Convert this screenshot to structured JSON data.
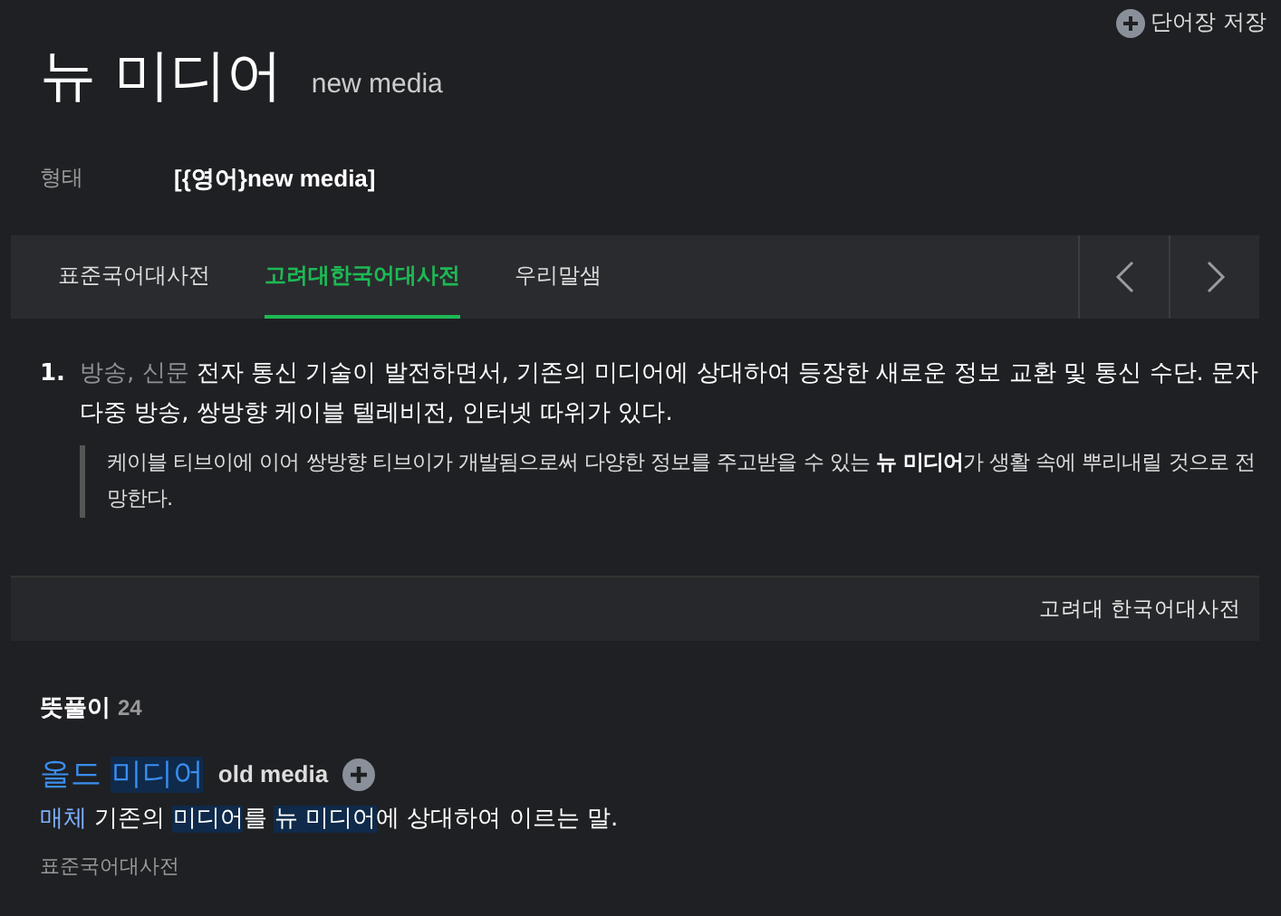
{
  "header": {
    "word": "뉴 미디어",
    "original": "new media",
    "save_label": "단어장 저장"
  },
  "form": {
    "label": "형태",
    "value": "[{영어}new media]"
  },
  "tabs": [
    {
      "label": "표준국어대사전",
      "selected": false
    },
    {
      "label": "고려대한국어대사전",
      "selected": true
    },
    {
      "label": "우리말샘",
      "selected": false
    }
  ],
  "definitions": [
    {
      "number": "1.",
      "categories": "방송, 신문",
      "text": "전자 통신 기술이 발전하면서, 기존의 미디어에 상대하여 등장한 새로운 정보 교환 및 통신 수단. 문자 다중 방송, 쌍방향 케이블 텔레비전, 인터넷 따위가 있다.",
      "example": "케이블 티브이에 이어 쌍방향 티브이가 개발됨으로써 다양한 정보를 주고받을 수 있는 **뉴 미디어**가 생활 속에 뿌리내릴 것으로 전망한다."
    }
  ],
  "source": "고려대 한국어대사전",
  "meanings": {
    "title": "뜻풀이",
    "count": "24",
    "entries": [
      {
        "word": [
          {
            "text": "올드 ",
            "highlighted": false
          },
          {
            "text": "미디어",
            "highlighted": true
          }
        ],
        "original": "old media",
        "category": "매체",
        "definition": [
          {
            "text": "기존의 ",
            "highlighted": false
          },
          {
            "text": "미디어",
            "highlighted": true
          },
          {
            "text": "를 ",
            "highlighted": false
          },
          {
            "text": "뉴 미디어",
            "highlighted": true
          },
          {
            "text": "에 상대하여 이르는 말.",
            "highlighted": false
          }
        ],
        "dictionary": "표준국어대사전"
      }
    ]
  }
}
